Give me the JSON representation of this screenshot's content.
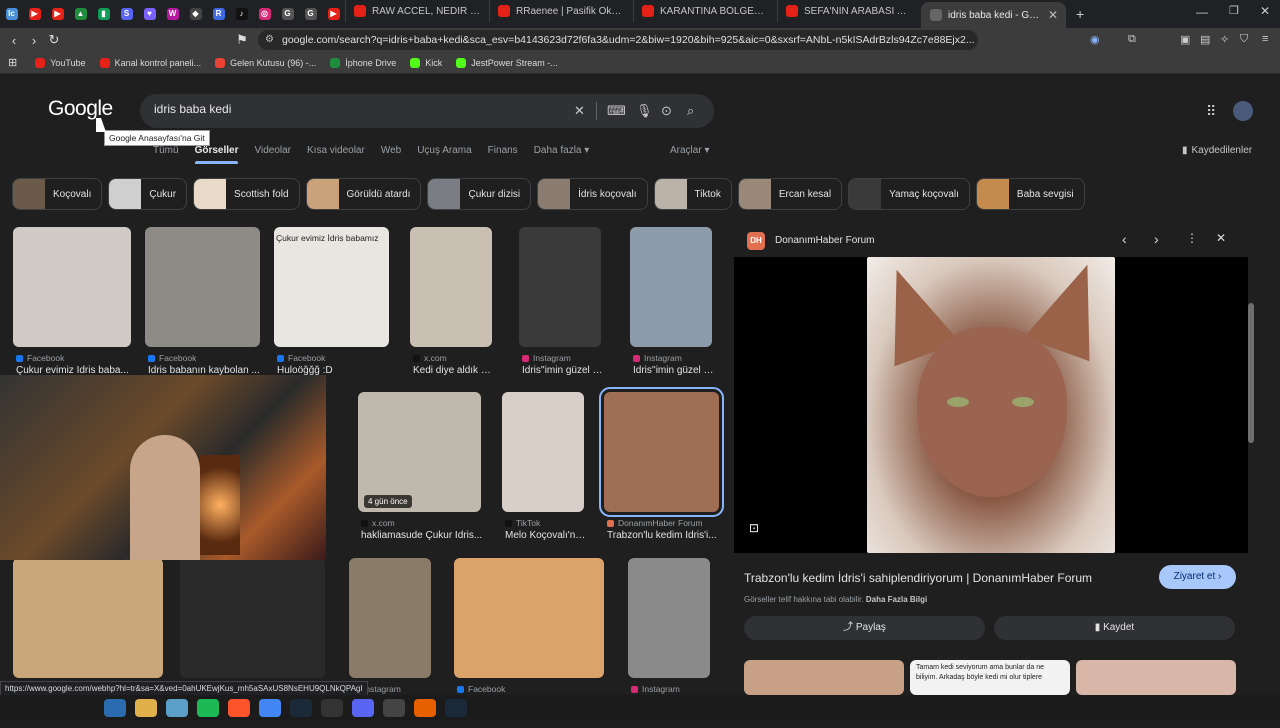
{
  "browser": {
    "pinned_tabs": [
      {
        "icon": "chart-icon",
        "color": "#4a90d9",
        "label": "lc"
      },
      {
        "icon": "youtube-icon",
        "color": "#e62117",
        "label": "▶"
      },
      {
        "icon": "youtube-icon",
        "color": "#e62117",
        "label": "▶"
      },
      {
        "icon": "drive-icon",
        "color": "#1e8e3e",
        "label": "▲"
      },
      {
        "icon": "sheets-icon",
        "color": "#0f9d58",
        "label": "▮"
      },
      {
        "icon": "mesh-icon",
        "color": "#5865f2",
        "label": "S"
      },
      {
        "icon": "shield-icon",
        "color": "#7b61ff",
        "label": "♥"
      },
      {
        "icon": "brand-icon",
        "color": "#b5179e",
        "label": "W"
      },
      {
        "icon": "diamond-icon",
        "color": "#444",
        "label": "◆"
      },
      {
        "icon": "r-icon",
        "color": "#4169e1",
        "label": "R"
      },
      {
        "icon": "tiktok-icon",
        "color": "#111",
        "label": "♪"
      },
      {
        "icon": "instagram-icon",
        "color": "#d62976",
        "label": "◎"
      },
      {
        "icon": "google-icon",
        "color": "#555",
        "label": "G"
      },
      {
        "icon": "google-icon",
        "color": "#555",
        "label": "G"
      },
      {
        "icon": "youtube-icon",
        "color": "#e62117",
        "label": "▶"
      }
    ],
    "tabs": [
      {
        "title": "RAW ACCEL, NEDİR NASIL KUR...",
        "icon": "youtube-icon",
        "color": "#e62117"
      },
      {
        "title": "RRaenee | Pasifik Okyanusunda",
        "icon": "youtube-icon",
        "color": "#e62117"
      },
      {
        "title": "KARANTİNA BÖLGESİNİN BAŞIN",
        "icon": "youtube-icon",
        "color": "#e62117"
      },
      {
        "title": "SEFA'NIN ARABASI ARTIK YOK |",
        "icon": "youtube-icon",
        "color": "#e62117"
      },
      {
        "title": "idris baba kedi - Google'da",
        "icon": "google-icon",
        "color": "#666",
        "active": true
      }
    ],
    "new_tab_label": "+",
    "url": "google.com/search?q=idris+baba+kedi&sca_esv=b4143623d72f6fa3&udm=2&biw=1920&bih=925&aic=0&sxsrf=ANbL-n5kISAdrBzls94Zc7e88Ejx2...",
    "bookmarks": [
      {
        "label": "YouTube",
        "icon": "youtube-icon",
        "color": "#e62117"
      },
      {
        "label": "Kanal kontrol paneli...",
        "icon": "youtube-icon",
        "color": "#e62117"
      },
      {
        "label": "Gelen Kutusu (96) -...",
        "icon": "gmail-icon",
        "color": "#ea4335"
      },
      {
        "label": "İphone Drive",
        "icon": "drive-icon",
        "color": "#1e8e3e"
      },
      {
        "label": "Kick",
        "icon": "kick-icon",
        "color": "#53fc18"
      },
      {
        "label": "JestPower Stream -...",
        "icon": "kick-icon",
        "color": "#53fc18"
      }
    ]
  },
  "google": {
    "logo": "Google",
    "logo_tooltip": "Google Anasayfası'na Git",
    "query": "idris baba kedi",
    "nav": [
      "Tümü",
      "Görseller",
      "Videolar",
      "Kısa videolar",
      "Web",
      "Uçuş Arama",
      "Finans",
      "Daha fazla ▾"
    ],
    "nav_active_index": 1,
    "tools": "Araçlar ▾",
    "saved": "Kaydedilenler",
    "chips": [
      {
        "label": "Koçovalı",
        "color": "#6b5a4a"
      },
      {
        "label": "Çukur",
        "color": "#cfcfcf"
      },
      {
        "label": "Scottish fold",
        "color": "#e8d9c8"
      },
      {
        "label": "Görüldü atardı",
        "color": "#c9a27a"
      },
      {
        "label": "Çukur dizisi",
        "color": "#7a7d83"
      },
      {
        "label": "İdris koçovalı",
        "color": "#8a7c70"
      },
      {
        "label": "Tiktok",
        "color": "#bbb2a8"
      },
      {
        "label": "Ercan kesal",
        "color": "#9a8878"
      },
      {
        "label": "Yamaç koçovalı",
        "color": "#3a3a3a"
      },
      {
        "label": "Baba sevgisi",
        "color": "#c58a4e"
      }
    ],
    "results": [
      {
        "source": "Facebook",
        "source_color": "#1877f2",
        "title": "Çukur evimiz İdris baba...",
        "color": "#cfcac4"
      },
      {
        "source": "Facebook",
        "source_color": "#1877f2",
        "title": "İdris babanın kaybolan ...",
        "color": "#8e8a86"
      },
      {
        "source": "Facebook",
        "source_color": "#1877f2",
        "title": "Huloöğğğ :D",
        "color": "#e9e6e2",
        "caption": "Çukur evimiz İdris babamız"
      },
      {
        "source": "x.com",
        "source_color": "#111",
        "title": "Kedi diye aldık Çu...",
        "color": "#c9bfb3"
      },
      {
        "source": "Instagram",
        "source_color": "#d62976",
        "title": "İdris''imin güzel ba...",
        "color": "#3a3a3a"
      },
      {
        "source": "Instagram",
        "source_color": "#d62976",
        "title": "İdris''imin güzel ba...",
        "color": "#8d9bab"
      },
      {
        "source": "x.com",
        "source_color": "#111",
        "title": "hakliamasude Çukur İdris...",
        "color": "#bfb8ad",
        "badge": "4 gün önce"
      },
      {
        "source": "TikTok",
        "source_color": "#111",
        "title": "Melo Koçovalı'nın ...",
        "color": "#d8d0c8"
      },
      {
        "source": "DonanımHaber Forum",
        "source_color": "#e07050",
        "title": "Trabzon'lu kedim İdris'i...",
        "color": "#a06d55"
      },
      {
        "source": "Instagram",
        "source_color": "#d62976",
        "title": "",
        "color": "#caa77a"
      },
      {
        "source": "",
        "source_color": "#333",
        "title": "",
        "color": "#2a2a2a"
      },
      {
        "source": "Instagram",
        "source_color": "#d62976",
        "title": "",
        "color": "#8a7a68"
      },
      {
        "source": "Facebook",
        "source_color": "#1877f2",
        "title": "",
        "color": "#d9a36a"
      },
      {
        "source": "Instagram",
        "source_color": "#d62976",
        "title": "",
        "color": "#8a8a8a"
      }
    ]
  },
  "panel": {
    "source": "DonanımHaber Forum",
    "title": "Trabzon'lu kedim İdris'i sahiplendiriyorum | DonanımHaber Forum",
    "subtitle": "Görseller telif hakkına tabi olabilir.",
    "more_info": "Daha Fazla Bilgi",
    "visit": "Ziyaret et ›",
    "share": "Paylaş",
    "save": "Kaydet",
    "related_text": "Tamam kedi seviyorum ama bunlar da ne biliyim. Arkadaş böyle kedi mi olur tiplere"
  },
  "status_url": "https://www.google.com/webhp?hl=tr&sa=X&ved=0ahUKEwjKus_mh5aSAxUS8NsEHU9QLNkQPAgI",
  "taskbar": [
    {
      "icon": "start-icon",
      "color": "#2b6cb0"
    },
    {
      "icon": "folder-icon",
      "color": "#e0b14a"
    },
    {
      "icon": "notepad-icon",
      "color": "#5aa0c8"
    },
    {
      "icon": "spotify-icon",
      "color": "#1db954"
    },
    {
      "icon": "brave-icon",
      "color": "#fb542b"
    },
    {
      "icon": "chrome-icon",
      "color": "#4285f4"
    },
    {
      "icon": "steam-icon",
      "color": "#1b2838"
    },
    {
      "icon": "epic-icon",
      "color": "#333"
    },
    {
      "icon": "discord-icon",
      "color": "#5865f2"
    },
    {
      "icon": "obs-icon",
      "color": "#444"
    },
    {
      "icon": "firefox-icon",
      "color": "#e66000"
    },
    {
      "icon": "steam-icon",
      "color": "#1b2838"
    }
  ]
}
